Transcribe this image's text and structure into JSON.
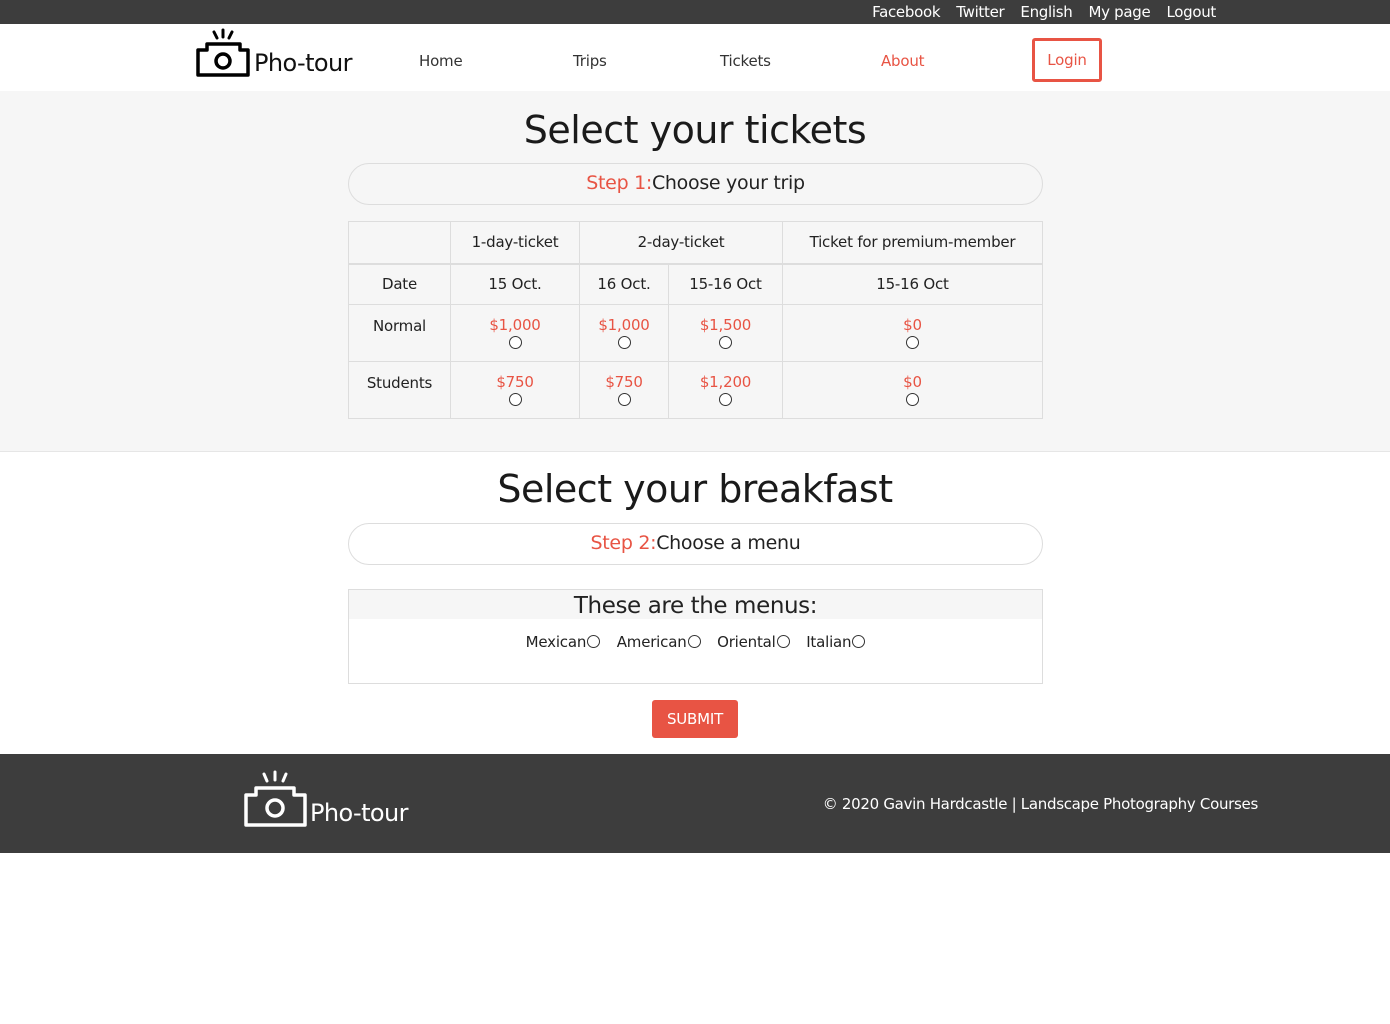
{
  "topbar": {
    "links": [
      "Facebook",
      "Twitter",
      "English",
      "My page",
      "Logout"
    ]
  },
  "header": {
    "brand": "Pho-tour",
    "nav": [
      "Home",
      "Trips",
      "Tickets",
      "About"
    ],
    "active_nav": "About",
    "login": "Login"
  },
  "tickets_section": {
    "title": "Select your tickets",
    "step_label": "Step 1:",
    "step_text": "Choose your trip",
    "table": {
      "headers": [
        "",
        "1-day-ticket",
        "2-day-ticket",
        "Ticket for premium-member"
      ],
      "dates_label": "Date",
      "dates": [
        "15 Oct.",
        "16 Oct.",
        "15-16 Oct",
        "15-16 Oct"
      ],
      "rows": [
        {
          "label": "Normal",
          "prices": [
            "$1,000",
            "$1,000",
            "$1,500",
            "$0"
          ]
        },
        {
          "label": "Students",
          "prices": [
            "$750",
            "$750",
            "$1,200",
            "$0"
          ]
        }
      ]
    }
  },
  "breakfast_section": {
    "title": "Select your breakfast",
    "step_label": "Step 2:",
    "step_text": "Choose a menu",
    "menus_title": "These are the menus:",
    "menus": [
      "Mexican",
      "American",
      "Oriental",
      "Italian"
    ]
  },
  "submit_label": "SUBMIT",
  "footer": {
    "brand": "Pho-tour",
    "copyright": "© 2020 Gavin Hardcastle | Landscape Photography Courses"
  },
  "colors": {
    "accent": "#e85444",
    "dark_bar": "#3d3d3d",
    "section_bg": "#f6f6f6"
  }
}
